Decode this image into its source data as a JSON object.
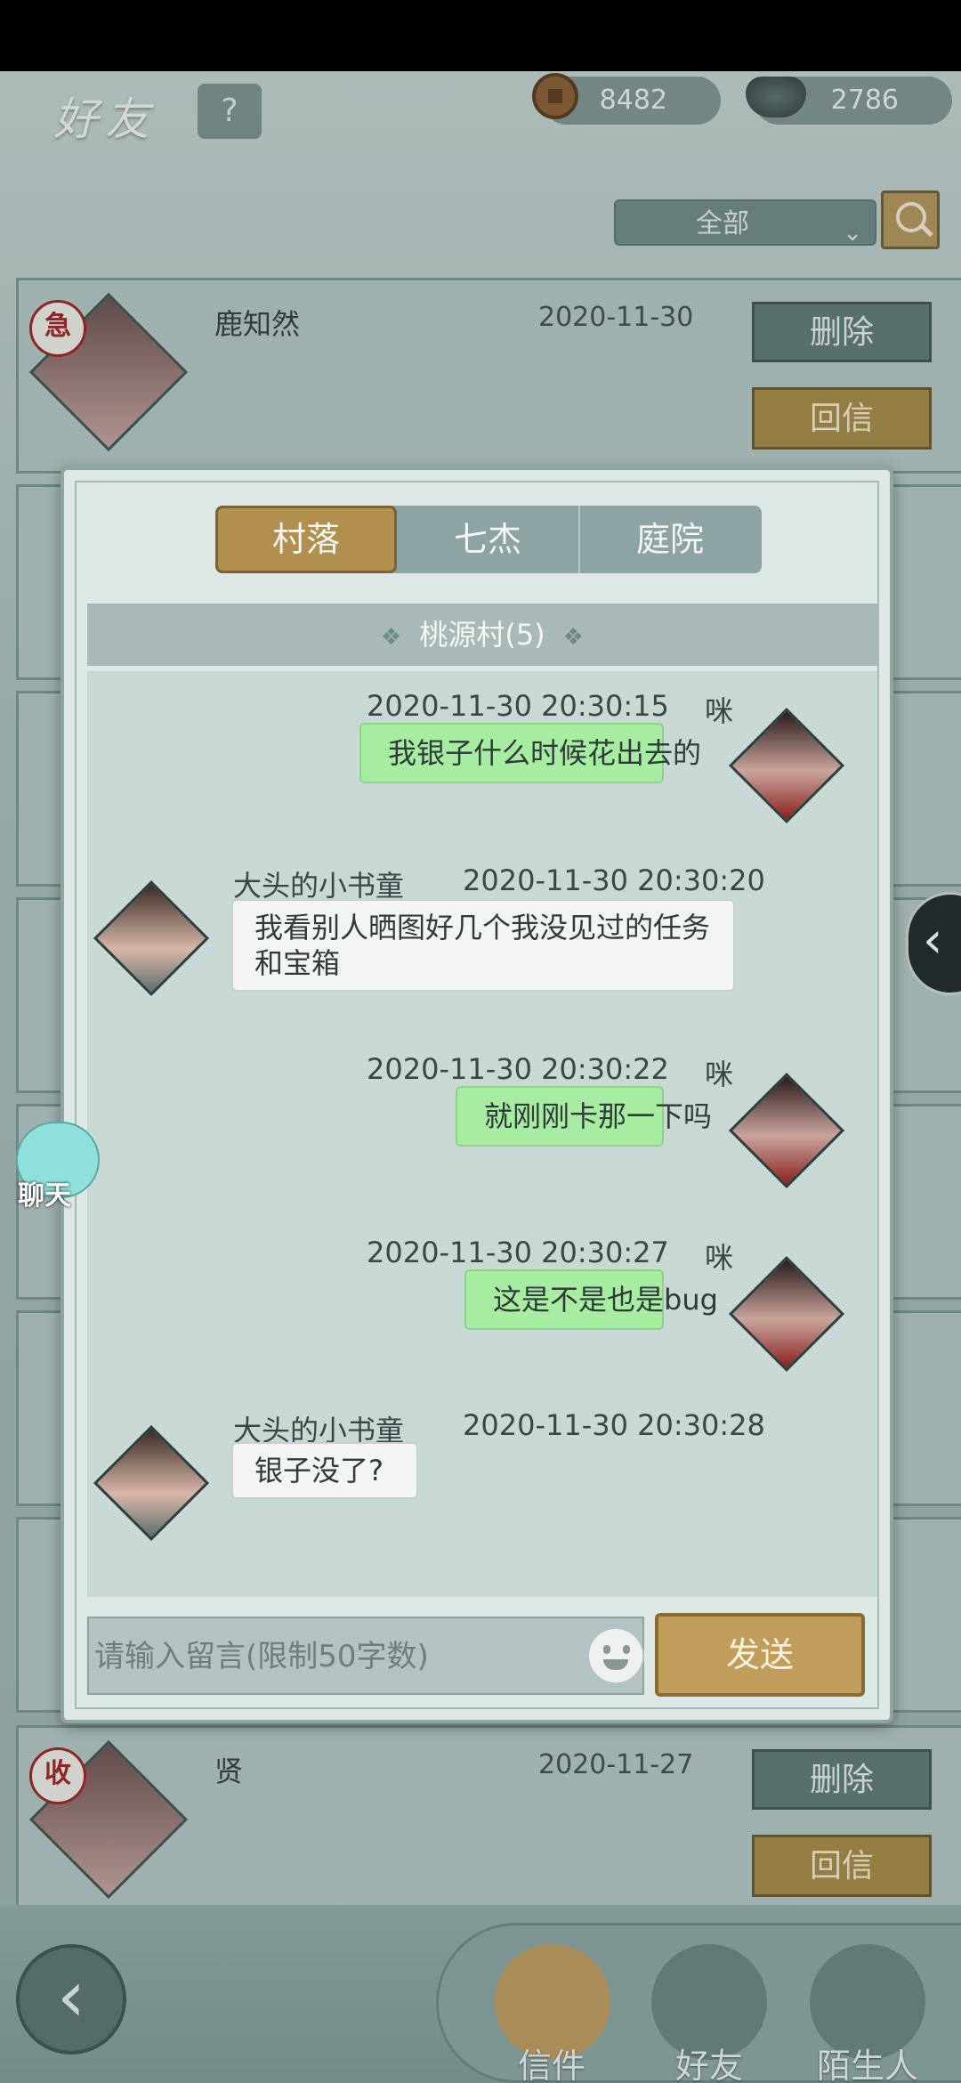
{
  "header": {
    "title": "好友",
    "help": "?",
    "coins": "8482",
    "silver": "2786"
  },
  "filter": {
    "selected": "全部"
  },
  "list": {
    "rows": [
      {
        "badge": "急",
        "name": "鹿知然",
        "date": "2020-11-30",
        "delete_label": "删除",
        "reply_label": "回信"
      },
      {
        "badge": "收",
        "name": "贤",
        "date": "2020-11-27",
        "delete_label": "删除",
        "reply_label": "回信"
      }
    ]
  },
  "modal": {
    "tabs": [
      {
        "label": "村落",
        "active": true
      },
      {
        "label": "七杰",
        "active": false
      },
      {
        "label": "庭院",
        "active": false
      }
    ],
    "channel": "桃源村(5)",
    "channel_deco": "❖",
    "messages": [
      {
        "side": "me",
        "time": "2020-11-30  20:30:15",
        "sender": "咪",
        "text": "我银子什么时候花出去的"
      },
      {
        "side": "other",
        "time": "2020-11-30  20:30:20",
        "sender": "大头的小书童",
        "text": "我看别人晒图好几个我没见过的任务和宝箱"
      },
      {
        "side": "me",
        "time": "2020-11-30  20:30:22",
        "sender": "咪",
        "text": "就刚刚卡那一下吗"
      },
      {
        "side": "me",
        "time": "2020-11-30  20:30:27",
        "sender": "咪",
        "text": "这是不是也是bug"
      },
      {
        "side": "other",
        "time": "2020-11-30  20:30:28",
        "sender": "大头的小书童",
        "text": "银子没了?"
      }
    ],
    "input_placeholder": "请输入留言(限制50字数)",
    "send_label": "发送"
  },
  "float": {
    "chat_label": "聊天"
  },
  "nav": {
    "mail_label": "信件",
    "friends_label": "好友",
    "strangers_label": "陌生人"
  },
  "colors": {
    "accent_gold": "#b08f4f",
    "my_bubble": "#a7eda1"
  }
}
